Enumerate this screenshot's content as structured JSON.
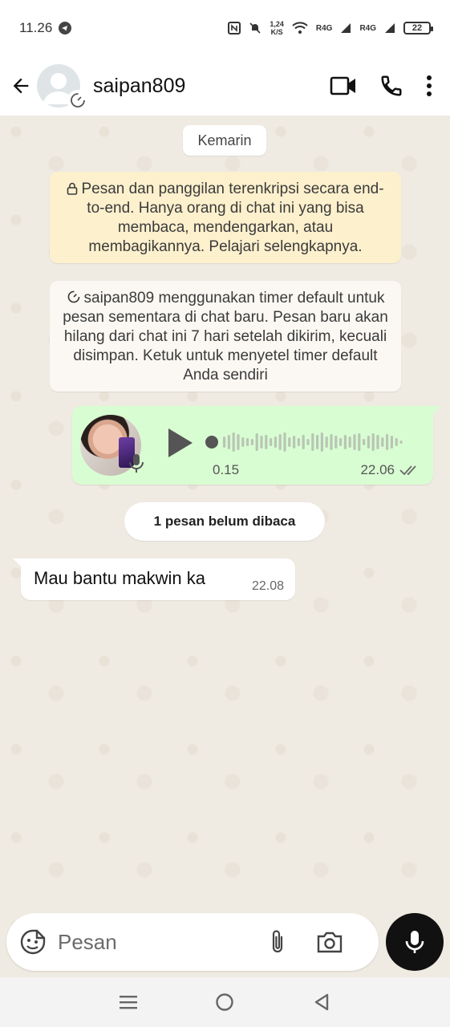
{
  "status_bar": {
    "time": "11.26",
    "net_speed_value": "1,24",
    "net_speed_unit": "K/S",
    "signal1": "R4G",
    "signal2": "R4G",
    "battery": "22"
  },
  "header": {
    "contact_name": "saipan809",
    "icons": [
      "back-arrow-icon",
      "avatar",
      "timer-icon",
      "video-call-icon",
      "phone-call-icon",
      "more-vert-icon"
    ]
  },
  "chat": {
    "date_chip": "Kemarin",
    "encryption_notice": "Pesan dan panggilan terenkripsi secara end-to-end. Hanya orang di chat ini yang bisa membaca, mendengarkan, atau membagikannya. Pelajari selengkapnya.",
    "timer_notice": "saipan809 menggunakan timer default untuk pesan sementara di chat baru. Pesan baru akan hilang dari chat ini 7 hari setelah dikirim, kecuali disimpan. Ketuk untuk menyetel timer default Anda sendiri",
    "voice_message": {
      "duration": "0.15",
      "time": "22.06",
      "status": "read"
    },
    "unread_chip": "1 pesan belum dibaca",
    "incoming_message": {
      "text": "Mau bantu makwin ka",
      "time": "22.08"
    }
  },
  "composer": {
    "placeholder": "Pesan"
  },
  "colors": {
    "chat_bg": "#efeae2",
    "outgoing_bubble": "#d9fdd3",
    "encryption_notice_bg": "#fdf0cd",
    "mic_button": "#111111"
  }
}
